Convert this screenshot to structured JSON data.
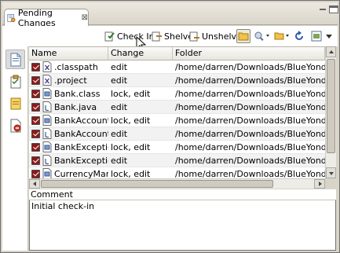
{
  "tab": {
    "title": "Pending Changes",
    "close": "⊠"
  },
  "toolbar": {
    "checkin_label": "Check In",
    "shelve_label": "Shelve",
    "unshelve_label": "Unshelve"
  },
  "table": {
    "headers": {
      "name": "Name",
      "change": "Change",
      "folder": "Folder"
    },
    "rows": [
      {
        "name": ".classpath",
        "change": "edit",
        "folder": "/home/darren/Downloads/BlueYonder.Legacy",
        "icon": "x-file-icon"
      },
      {
        "name": ".project",
        "change": "edit",
        "folder": "/home/darren/Downloads/BlueYonder.Legacy",
        "icon": "x-file-icon"
      },
      {
        "name": "Bank.class",
        "change": "lock, edit",
        "folder": "/home/darren/Downloads/BlueYonder.Legacy",
        "icon": "class-file-icon"
      },
      {
        "name": "Bank.java",
        "change": "edit",
        "folder": "/home/darren/Downloads/BlueYonder.Legacy",
        "icon": "java-file-icon"
      },
      {
        "name": "BankAccount.clas",
        "change": "lock, edit",
        "folder": "/home/darren/Downloads/BlueYonder.Legacy",
        "icon": "class-file-icon"
      },
      {
        "name": "BankAccount.java",
        "change": "edit",
        "folder": "/home/darren/Downloads/BlueYonder.Legacy",
        "icon": "java-file-icon"
      },
      {
        "name": "BankException.cl",
        "change": "lock, edit",
        "folder": "/home/darren/Downloads/BlueYonder.Legacy",
        "icon": "class-file-icon"
      },
      {
        "name": "BankException.ja",
        "change": "edit",
        "folder": "/home/darren/Downloads/BlueYonder.Legacy",
        "icon": "java-file-icon"
      },
      {
        "name": "CurrencyManipula",
        "change": "lock, edit",
        "folder": "/home/darren/Downloads/BlueYonder.Legacy",
        "icon": "class-file-icon"
      },
      {
        "name": "CurrencyManipula",
        "change": "edit",
        "folder": "/home/darren/Downloads/BlueYonder.Legacy",
        "icon": "java-file-icon"
      }
    ]
  },
  "comment": {
    "label": "Comment",
    "value": "Initial check-in"
  },
  "colors": {
    "checkbox": "#8b1a1a",
    "accent_toolbar": "#f0c24a"
  }
}
